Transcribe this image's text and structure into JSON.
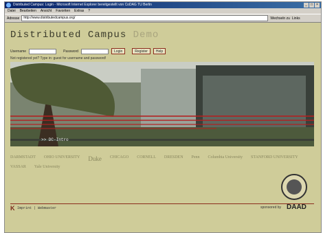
{
  "window": {
    "title": "Distributed Campus: Login - Microsoft Internet Explorer bereitgestellt von CoDAG TU Berlin",
    "controls": [
      "_",
      "□",
      "×"
    ]
  },
  "menu": [
    "Datei",
    "Bearbeiten",
    "Ansicht",
    "Favoriten",
    "Extras",
    "?"
  ],
  "address": {
    "label": "Adresse",
    "url": "http://www.distributedcampus.org/",
    "go": "Wechseln zu",
    "links": "Links"
  },
  "site": {
    "title": "Distributed Campus",
    "title_suffix": "Demo"
  },
  "login": {
    "username_label": "Username",
    "password_label": "Password",
    "login_button": "Login",
    "register_button": "Register",
    "help_button": "Help",
    "hint": "Not registered yet? Type in: guest for username and password!"
  },
  "photo": {
    "intro_link": ">> DC-Intro"
  },
  "logos": [
    "DARMSTADT",
    "OHIO UNIVERSITY",
    "Duke",
    "CHICAGO",
    "CORNELL",
    "DRESDEN",
    "Penn",
    "Columbia University",
    "STANFORD UNIVERSITY",
    "VASSAR",
    "Yale University"
  ],
  "footer": {
    "logo": "K",
    "links": "Imprint | Webmaster",
    "sponsor_label": "sponsored by",
    "sponsor": "DAAD"
  },
  "colors": {
    "page_bg": "#cfcc99",
    "accent": "#8b2b1c"
  }
}
